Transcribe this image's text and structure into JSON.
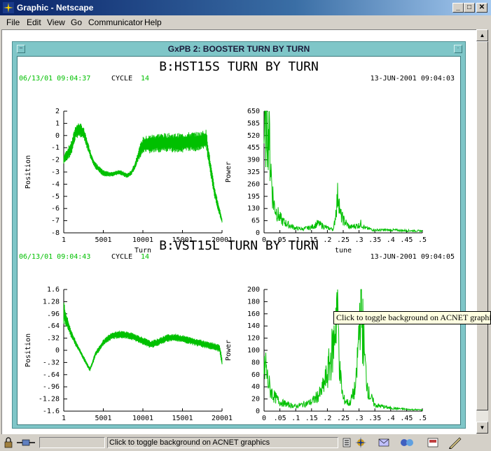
{
  "window": {
    "title": "Graphic - Netscape"
  },
  "menu": [
    {
      "label": "File"
    },
    {
      "label": "Edit"
    },
    {
      "label": "View"
    },
    {
      "label": "Go"
    },
    {
      "label": "Communicator"
    },
    {
      "label": "Help"
    }
  ],
  "frame": {
    "title": "GxPB 2: BOOSTER TURN BY TURN"
  },
  "panels": [
    {
      "title": "B:HST15S TURN BY TURN",
      "date_left": "06/13/01 09:04:37",
      "cycle_label": "CYCLE",
      "cycle_value": "14",
      "date_right": "13-JUN-2001 09:04:03"
    },
    {
      "title": "B:VST15L TURN BY TURN",
      "date_left": "06/13/01 09:04:43",
      "cycle_label": "CYCLE",
      "cycle_value": "14",
      "date_right": "13-JUN-2001 09:04:05"
    }
  ],
  "chart_data": [
    {
      "type": "line",
      "panel": "B:HST15S TURN BY TURN",
      "xlabel": "Turn",
      "ylabel": "Position",
      "xlim": [
        1,
        20001
      ],
      "ylim": [
        -8,
        2
      ],
      "xticks": [
        "1",
        "5001",
        "10001",
        "15001",
        "20001"
      ],
      "yticks": [
        "2",
        "1",
        "0",
        "-1",
        "-2",
        "-3",
        "-4",
        "-5",
        "-6",
        "-7",
        "-8"
      ],
      "x": [
        1,
        500,
        1000,
        1500,
        2000,
        2500,
        3000,
        3500,
        4000,
        5000,
        6000,
        7000,
        8000,
        8500,
        9000,
        9500,
        10000,
        11000,
        12000,
        13000,
        14000,
        15000,
        16000,
        17000,
        18000,
        18500,
        19000,
        19500,
        20001
      ],
      "y": [
        -2.0,
        -1.5,
        -1.0,
        0.3,
        0.5,
        0.2,
        -0.8,
        -1.8,
        -2.5,
        -3.1,
        -3.2,
        -3.0,
        -3.3,
        -3.1,
        -2.5,
        -1.5,
        -0.8,
        -0.7,
        -0.6,
        -0.6,
        -0.6,
        -0.6,
        -0.5,
        -0.5,
        -0.3,
        -2.5,
        -4.5,
        -5.8,
        -7.0
      ],
      "noise_amplitude": [
        0.4,
        0.5,
        0.6,
        0.6,
        0.6,
        0.5,
        0.4,
        0.3,
        0.3,
        0.25,
        0.2,
        0.2,
        0.2,
        0.2,
        0.3,
        0.5,
        0.7,
        0.8,
        0.8,
        0.8,
        0.8,
        0.8,
        0.8,
        0.8,
        0.8,
        0.6,
        0.5,
        0.4,
        0.2
      ]
    },
    {
      "type": "line",
      "panel": "B:HST15S TURN BY TURN",
      "xlabel": "tune",
      "ylabel": "Power",
      "xlim": [
        0,
        0.5
      ],
      "ylim": [
        0,
        650
      ],
      "xticks": [
        "0",
        ".05",
        ".1",
        ".15",
        ".2",
        ".25",
        ".3",
        ".35",
        ".4",
        ".45",
        ".5"
      ],
      "yticks": [
        "650",
        "585",
        "520",
        "455",
        "390",
        "325",
        "260",
        "195",
        "130",
        "65",
        "0"
      ],
      "x": [
        0,
        0.005,
        0.01,
        0.015,
        0.02,
        0.025,
        0.03,
        0.04,
        0.05,
        0.06,
        0.08,
        0.1,
        0.12,
        0.15,
        0.17,
        0.2,
        0.22,
        0.235,
        0.24,
        0.25,
        0.27,
        0.3,
        0.305,
        0.32,
        0.35,
        0.4,
        0.45,
        0.5
      ],
      "y": [
        520,
        600,
        640,
        560,
        400,
        250,
        160,
        110,
        80,
        60,
        40,
        25,
        20,
        30,
        50,
        25,
        20,
        230,
        100,
        70,
        30,
        40,
        50,
        25,
        15,
        15,
        12,
        10
      ]
    },
    {
      "type": "line",
      "panel": "B:VST15L TURN BY TURN",
      "xlabel": "Turn",
      "ylabel": "Position",
      "xlim": [
        1,
        20001
      ],
      "ylim": [
        -1.6,
        1.6
      ],
      "xticks": [
        "1",
        "5001",
        "10001",
        "15001",
        "20001"
      ],
      "yticks": [
        "1.6",
        "1.28",
        ".96",
        ".64",
        ".32",
        "0",
        "-.32",
        "-.64",
        "-.96",
        "-1.28",
        "-1.6"
      ],
      "x": [
        1,
        500,
        1000,
        1500,
        2000,
        2500,
        3000,
        3300,
        3600,
        4000,
        5000,
        6000,
        7000,
        8000,
        9000,
        10000,
        11000,
        12000,
        13000,
        14000,
        15000,
        16000,
        17000,
        18000,
        19000,
        19700,
        20001
      ],
      "y": [
        1.0,
        0.7,
        0.4,
        0.2,
        0.0,
        -0.2,
        -0.4,
        -0.5,
        -0.35,
        -0.1,
        0.2,
        0.38,
        0.42,
        0.4,
        0.34,
        0.25,
        0.15,
        0.22,
        0.32,
        0.34,
        0.3,
        0.25,
        0.2,
        0.15,
        0.1,
        0.05,
        -0.3
      ],
      "noise_amplitude": [
        0.3,
        0.15,
        0.1,
        0.08,
        0.06,
        0.06,
        0.06,
        0.05,
        0.06,
        0.07,
        0.08,
        0.1,
        0.1,
        0.1,
        0.1,
        0.1,
        0.1,
        0.1,
        0.1,
        0.1,
        0.1,
        0.1,
        0.1,
        0.1,
        0.1,
        0.1,
        0.1
      ]
    },
    {
      "type": "line",
      "panel": "B:VST15L TURN BY TURN",
      "xlabel": "tune",
      "ylabel": "Power",
      "xlim": [
        0,
        0.5
      ],
      "ylim": [
        0,
        200
      ],
      "xticks": [
        "0",
        ".05",
        ".1",
        ".15",
        ".2",
        ".25",
        ".3",
        ".35",
        ".4",
        ".45",
        ".5"
      ],
      "yticks": [
        "200",
        "180",
        "160",
        "140",
        "120",
        "100",
        "80",
        "60",
        "40",
        "20",
        "0"
      ],
      "x": [
        0,
        0.005,
        0.01,
        0.02,
        0.03,
        0.05,
        0.08,
        0.1,
        0.13,
        0.15,
        0.18,
        0.2,
        0.22,
        0.23,
        0.235,
        0.24,
        0.25,
        0.27,
        0.29,
        0.3,
        0.305,
        0.31,
        0.32,
        0.33,
        0.35,
        0.4,
        0.45,
        0.5
      ],
      "y": [
        60,
        80,
        55,
        35,
        25,
        15,
        10,
        8,
        12,
        15,
        30,
        60,
        110,
        180,
        130,
        60,
        20,
        12,
        40,
        130,
        195,
        150,
        70,
        30,
        10,
        5,
        3,
        2
      ]
    }
  ],
  "tooltip": {
    "text": "Click to toggle background on ACNET graphics"
  },
  "status": {
    "text": "Click to toggle background on ACNET graphics"
  },
  "colors": {
    "trace": "#00c000",
    "frame": "#7fc6c8",
    "titlebar": "#0a246a"
  }
}
